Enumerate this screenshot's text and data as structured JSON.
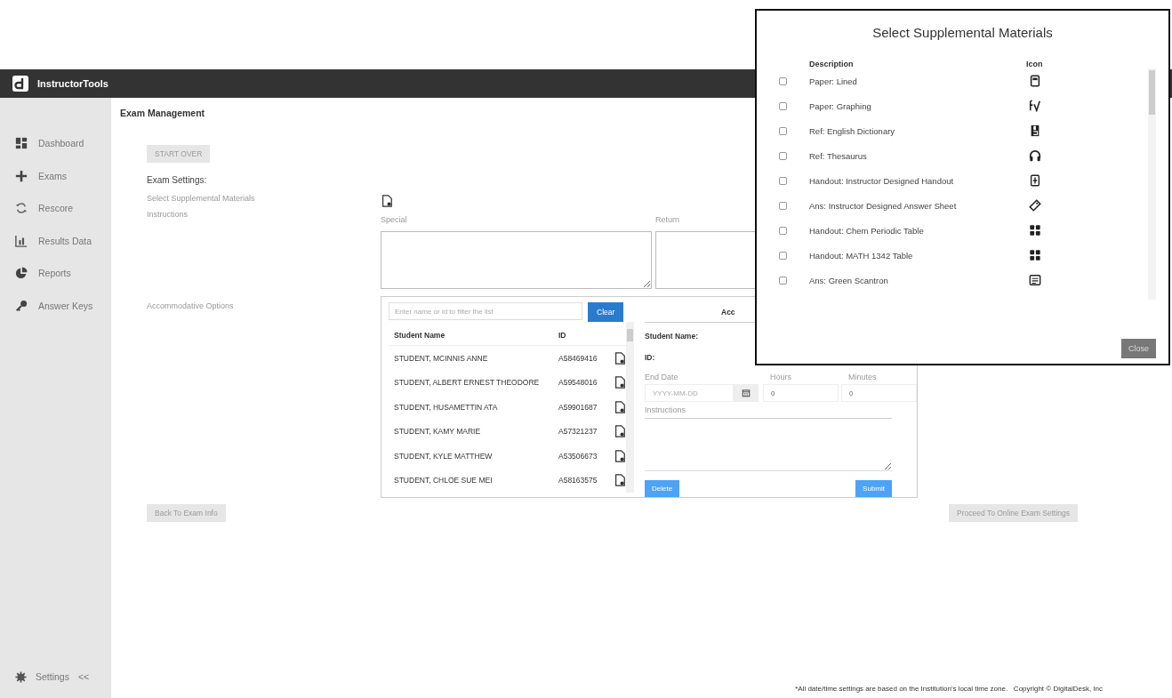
{
  "header": {
    "app_name": "InstructorTools"
  },
  "sidebar": {
    "items": [
      {
        "label": "Dashboard",
        "kind": "dashboard"
      },
      {
        "label": "Exams",
        "kind": "plus"
      },
      {
        "label": "Rescore",
        "kind": "refresh"
      },
      {
        "label": "Results Data",
        "kind": "chart"
      },
      {
        "label": "Reports",
        "kind": "pie"
      },
      {
        "label": "Answer Keys",
        "kind": "key"
      }
    ],
    "settings_label": "Settings",
    "collapse": "<<"
  },
  "page_title": "Exam Management",
  "start_over": "START OVER",
  "section_title": "Exam Settings:",
  "supplemental_label": "Select Supplemental Materials",
  "instructions": {
    "label": "Instructions",
    "special_label": "Special",
    "return_label": "Return"
  },
  "accommodative": {
    "label": "Accommodative Options",
    "filter_placeholder": "Enter name or id to filter the list",
    "clear": "Clear",
    "columns": [
      "Student Name",
      "ID"
    ],
    "students": [
      {
        "name": "STUDENT, MCINNIS ANNE",
        "id": "A58469416"
      },
      {
        "name": "STUDENT, ALBERT ERNEST THEODORE",
        "id": "A59548016"
      },
      {
        "name": "STUDENT, HUSAMETTIN ATA",
        "id": "A59901687"
      },
      {
        "name": "STUDENT, KAMY MARIE",
        "id": "A57321237"
      },
      {
        "name": "STUDENT, KYLE MATTHEW",
        "id": "A53506673"
      },
      {
        "name": "STUDENT, CHLOE SUE MEI",
        "id": "A58163575"
      }
    ],
    "form": {
      "title": "Acc",
      "student_name_label": "Student Name:",
      "id_label": "ID:",
      "end_date_label": "End Date",
      "end_date_placeholder": "YYYY-MM-DD",
      "hours_label": "Hours",
      "hours": "0",
      "minutes_label": "Minutes",
      "minutes": "0",
      "instructions_label": "Instructions",
      "delete": "Delete",
      "submit": "Submit"
    }
  },
  "back_button": "Back To Exam Info",
  "proceed_button": "Proceed To Online Exam Settings",
  "footer": "*All date/time settings are based on the Institution's local time zone.   Copyright © DigitalDesk, Inc",
  "modal": {
    "title": "Select Supplemental Materials",
    "columns": [
      "Description",
      "Icon"
    ],
    "items": [
      {
        "description": "Paper: Lined",
        "checked": false,
        "kind": "notebook"
      },
      {
        "description": "Paper: Graphing",
        "checked": false,
        "kind": "function"
      },
      {
        "description": "Ref: English Dictionary",
        "checked": false,
        "kind": "book"
      },
      {
        "description": "Ref: Thesaurus",
        "checked": false,
        "kind": "headphones"
      },
      {
        "description": "Handout: Instructor Designed Handout",
        "checked": false,
        "kind": "handout"
      },
      {
        "description": "Ans: Instructor Designed Answer Sheet",
        "checked": false,
        "kind": "tag"
      },
      {
        "description": "Handout: Chem Periodic Table",
        "checked": false,
        "kind": "grid"
      },
      {
        "description": "Handout: MATH 1342 Table",
        "checked": false,
        "kind": "grid"
      },
      {
        "description": "Ans: Green Scantron",
        "checked": false,
        "kind": "form"
      }
    ],
    "close": "Close"
  }
}
